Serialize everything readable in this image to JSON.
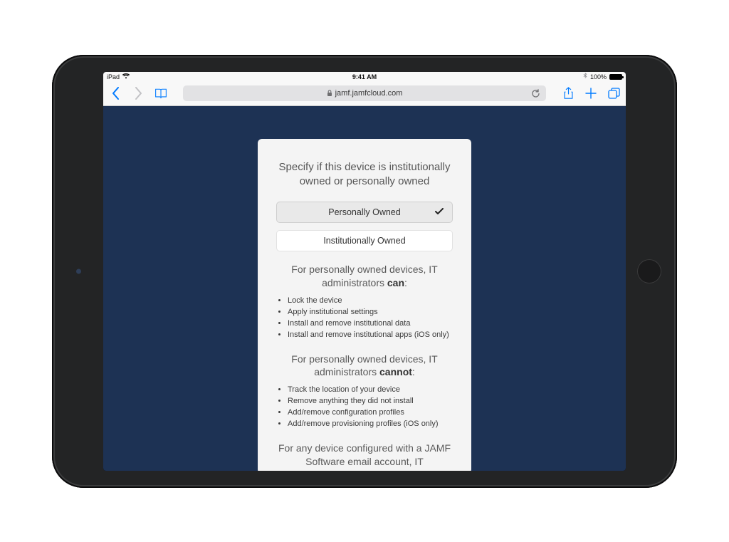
{
  "status": {
    "carrier": "iPad",
    "time": "9:41 AM",
    "battery_pct": "100%"
  },
  "toolbar": {
    "url": "jamf.jamfcloud.com"
  },
  "card": {
    "heading": "Specify if this device is institutionally owned or personally owned",
    "option_personal": "Personally Owned",
    "option_institutional": "Institutionally Owned",
    "can_lead": "For personally owned devices, IT administrators ",
    "can_word": "can",
    "can_items": [
      "Lock the device",
      "Apply institutional settings",
      "Install and remove institutional data",
      "Install and remove institutional apps (iOS only)"
    ],
    "cannot_lead": "For personally owned devices, IT administrators ",
    "cannot_word": "cannot",
    "cannot_items": [
      "Track the location of your device",
      "Remove anything they did not install",
      "Add/remove configuration profiles",
      "Add/remove provisioning profiles (iOS only)"
    ],
    "footer_lead": "For any device configured with a JAMF Software email account, IT"
  }
}
